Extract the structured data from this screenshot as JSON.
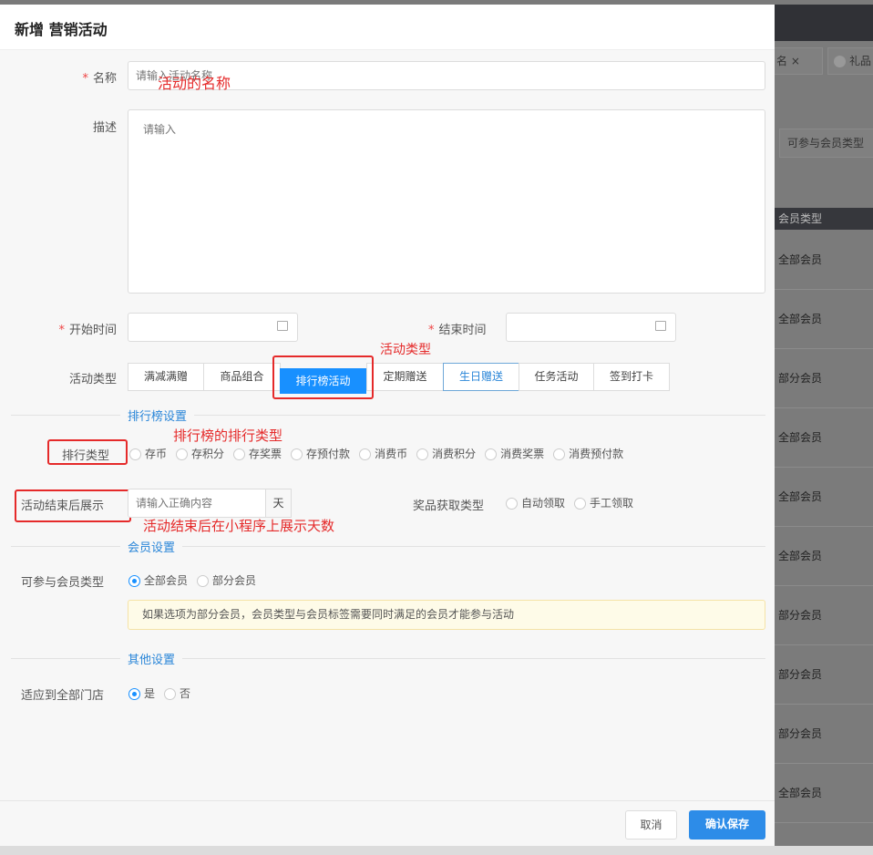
{
  "background": {
    "tabs": [
      "名 ×",
      "礼品"
    ],
    "filter_label": "可参与会员类型",
    "table_header": "会员类型",
    "rows": [
      "全部会员",
      "全部会员",
      "部分会员",
      "全部会员",
      "全部会员",
      "全部会员",
      "部分会员",
      "部分会员",
      "部分会员",
      "全部会员"
    ]
  },
  "modal": {
    "title": "新增 营销活动",
    "name_label": "名称",
    "name_placeholder": "请输入活动名称",
    "desc_label": "描述",
    "desc_placeholder": "请输入",
    "start_label": "开始时间",
    "end_label": "结束时间",
    "type_label": "活动类型",
    "types": [
      "满减满赠",
      "商品组合",
      "排行榜活动",
      "定期赠送",
      "生日赠送",
      "任务活动",
      "签到打卡"
    ],
    "rank_section": "排行榜设置",
    "rank_type_label": "排行类型",
    "rank_types": [
      "存币",
      "存积分",
      "存奖票",
      "存预付款",
      "消费币",
      "消费积分",
      "消费奖票",
      "消费预付款"
    ],
    "display_label": "活动结束后展示",
    "display_placeholder": "请输入正确内容",
    "display_unit": "天",
    "prize_label": "奖品获取类型",
    "prize_types": [
      "自动领取",
      "手工领取"
    ],
    "member_section": "会员设置",
    "member_label": "可参与会员类型",
    "member_types": [
      "全部会员",
      "部分会员"
    ],
    "member_tip": "如果选项为部分会员，会员类型与会员标签需要同时满足的会员才能参与活动",
    "other_section": "其他设置",
    "store_label": "适应到全部门店",
    "store_options": [
      "是",
      "否"
    ],
    "cancel": "取消",
    "save": "确认保存"
  },
  "annotations": {
    "name": "活动的名称",
    "type": "活动类型",
    "rank": "排行榜的排行类型",
    "display": "活动结束后在小程序上展示天数"
  },
  "colors": {
    "primary": "#1890ff",
    "annotation": "#e52a2a"
  }
}
